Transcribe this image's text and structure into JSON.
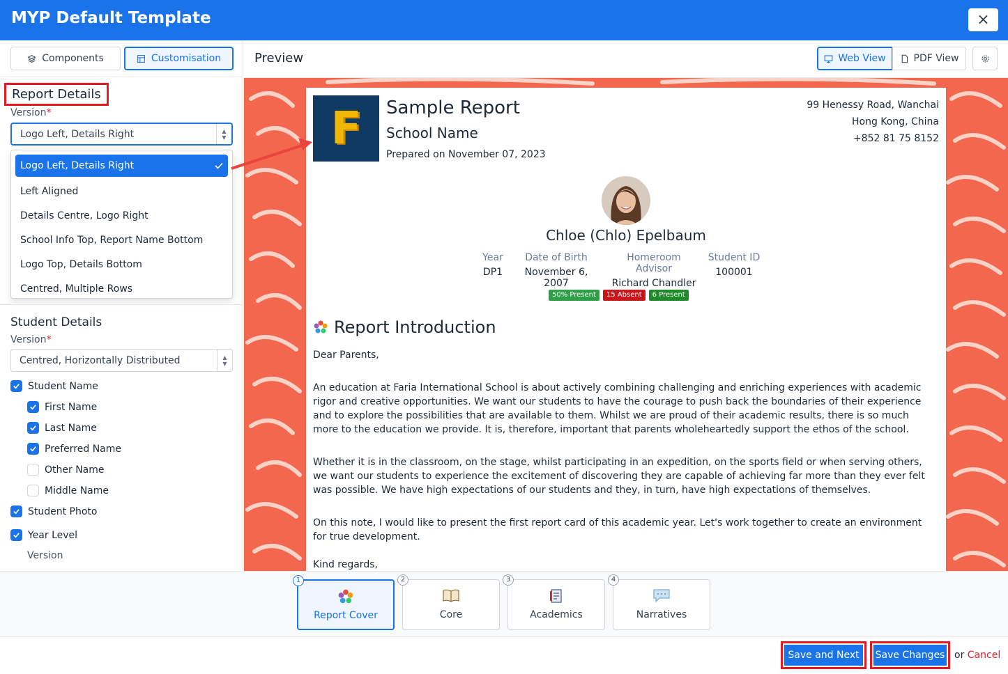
{
  "window": {
    "title": "MYP Default Template",
    "close_label": "×"
  },
  "sidebar": {
    "tabs": [
      {
        "label": "Components"
      },
      {
        "label": "Customisation"
      }
    ],
    "report_details": {
      "title": "Report Details",
      "version_label": "Version",
      "required_mark": "*",
      "version_value": "Logo Left, Details Right",
      "options": [
        "Logo Left, Details Right",
        "Left Aligned",
        "Details Centre, Logo Right",
        "School Info Top, Report Name Bottom",
        "Logo Top, Details Bottom",
        "Centred, Multiple Rows"
      ]
    },
    "student_details": {
      "title": "Student Details",
      "version_label": "Version",
      "version_value": "Centred, Horizontally Distributed",
      "checkboxes": [
        {
          "label": "Student Name",
          "checked": true
        },
        {
          "label": "First Name",
          "checked": true
        },
        {
          "label": "Last Name",
          "checked": true
        },
        {
          "label": "Preferred Name",
          "checked": true
        },
        {
          "label": "Other Name",
          "checked": false
        },
        {
          "label": "Middle Name",
          "checked": false
        },
        {
          "label": "Student Photo",
          "checked": true
        },
        {
          "label": "Year Level",
          "checked": true
        }
      ],
      "sub_version_label": "Version"
    }
  },
  "preview": {
    "title": "Preview",
    "web_view": "Web View",
    "pdf_view": "PDF View",
    "report": {
      "logo_letter": "F",
      "title": "Sample Report",
      "school": "School Name",
      "prepared": "Prepared on November 07, 2023",
      "address": [
        "99 Henessy Road, Wanchai",
        "Hong Kong, China",
        "+852 81 75 8152"
      ],
      "student_name": "Chloe (Chlo) Epelbaum",
      "info": [
        {
          "key": "Year",
          "value": "DP1"
        },
        {
          "key": "Date of Birth",
          "value": "November 6, 2007"
        },
        {
          "key": "Homeroom Advisor",
          "value": "Richard Chandler"
        },
        {
          "key": "Student ID",
          "value": "100001"
        }
      ],
      "badges": [
        {
          "label": "50% Present",
          "color": "#2e9e47"
        },
        {
          "label": "15 Absent",
          "color": "#c8161d"
        },
        {
          "label": "6 Present",
          "color": "#1e8a2a"
        }
      ],
      "intro_title": "Report Introduction",
      "greeting": "Dear Parents,",
      "paragraphs": [
        "An education at Faria International School is about actively combining challenging and enriching experiences with academic rigor and creative opportunities. We want our students to have the courage to push back the boundaries of their experience and to explore the possibilities that are available to them. Whilst we are proud of their academic results, there is so much more to the education we provide. It is, therefore, important that parents wholeheartedly support the ethos of the school.",
        "Whether it is in the classroom, on the stage, whilst participating in an expedition, on the sports field or when serving others, we want our students to experience the excitement of discovering they are capable of achieving far more than they ever felt was possible. We have high expectations of our students and they, in turn, have high expectations of themselves.",
        "On this note, I would like to present the first report card of this academic year. Let's work together to create an environment for true development."
      ],
      "closing": "Kind regards,"
    }
  },
  "steps": [
    {
      "num": "1",
      "label": "Report Cover"
    },
    {
      "num": "2",
      "label": "Core"
    },
    {
      "num": "3",
      "label": "Academics"
    },
    {
      "num": "4",
      "label": "Narratives"
    }
  ],
  "footer": {
    "save_next": "Save and Next",
    "save_changes": "Save Changes",
    "or": "or",
    "cancel": "Cancel"
  },
  "colors": {
    "primary": "#1a73e8",
    "highlight": "#e31b23",
    "preview_bg": "#f4674f",
    "logo_bg": "#0f3a63"
  }
}
